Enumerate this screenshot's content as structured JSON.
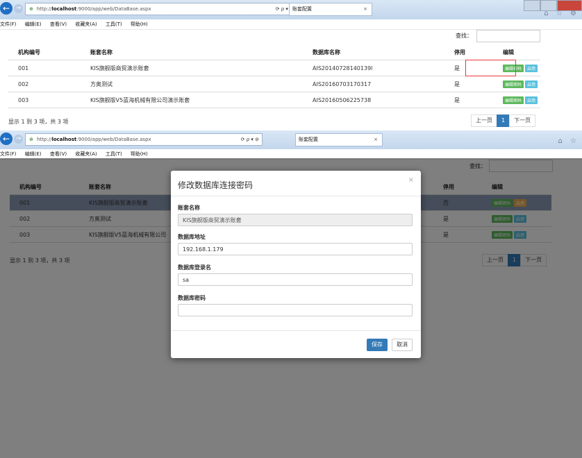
{
  "browser": {
    "url_prefix": "http://",
    "url_host": "localhost",
    "url_rest": ":9000/app/web/DataBase.aspx",
    "tab_title": "账套配置",
    "addr_tools": "⟳ ρ ▾ ⊘",
    "menu": [
      "文件(F)",
      "编辑(E)",
      "查看(V)",
      "收藏夹(A)",
      "工具(T)",
      "帮助(H)"
    ]
  },
  "search_label": "查找：",
  "table": {
    "headers": [
      "机构编号",
      "账套名称",
      "数据库名称",
      "停用",
      "编辑"
    ],
    "rows_top": [
      {
        "code": "001",
        "name": "KIS旗舰版商贸演示账套",
        "db": "AIS20140728140139l",
        "disabled": "是"
      },
      {
        "code": "002",
        "name": "方奥测试",
        "db": "AIS20160703170317",
        "disabled": "是"
      },
      {
        "code": "003",
        "name": "KIS旗舰版V5蓝海机械有限公司演示账套",
        "db": "AIS20160506225738",
        "disabled": "是"
      }
    ],
    "rows_bottom": [
      {
        "code": "001",
        "name": "KIS旗舰版商贸演示账套",
        "disabled": "否"
      },
      {
        "code": "002",
        "name": "方奥测试",
        "disabled": "是"
      },
      {
        "code": "003",
        "name": "KIS旗舰版V5蓝海机械有限公司",
        "disabled": "是"
      }
    ],
    "edit_label": "编辑密码",
    "enable_label": "启用"
  },
  "info": "显示 1 到 3 项，共 3 项",
  "pager": {
    "prev": "上一页",
    "page": "1",
    "next": "下一页"
  },
  "modal": {
    "title": "修改数据库连接密码",
    "close": "×",
    "fields": [
      {
        "label": "账套名称",
        "value": "KIS旗舰版商贸演示账套"
      },
      {
        "label": "数据库地址",
        "value": "192.168.1.179"
      },
      {
        "label": "数据库登录名",
        "value": "sa"
      },
      {
        "label": "数据库密码",
        "value": ""
      }
    ],
    "save": "保存",
    "cancel": "取消"
  },
  "colors": {
    "primary": "#337ab7",
    "success": "#5cb85c",
    "info": "#5bc0de",
    "warning": "#f0ad4e",
    "highlight": "#e8383d"
  }
}
